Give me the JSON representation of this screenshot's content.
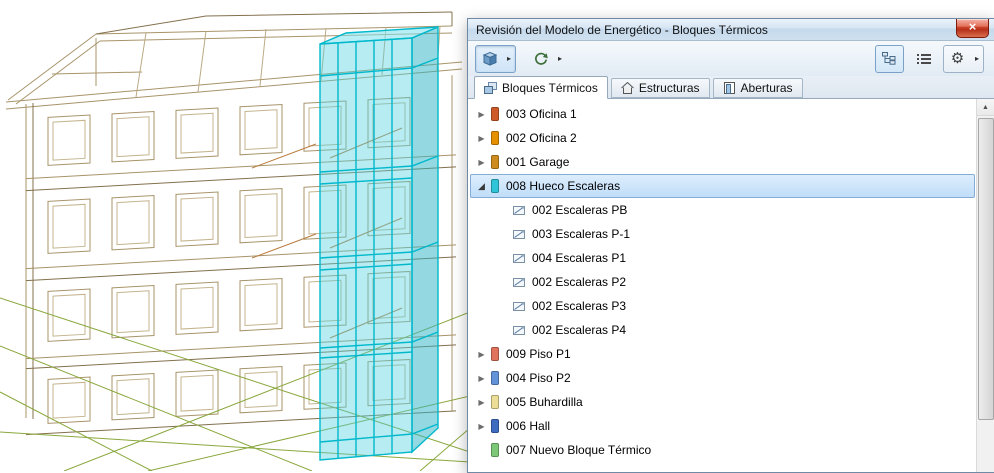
{
  "window": {
    "title": "Revisión del Modelo de Energético - Bloques Térmicos"
  },
  "icons": {
    "close": "×",
    "flyout_arrow": "▸",
    "gear": "⚙",
    "scroll_up": "▲",
    "collapsed_expander": "▶",
    "expanded_expander": "◢"
  },
  "tabs": [
    {
      "label": "Bloques Térmicos",
      "active": true
    },
    {
      "label": "Estructuras",
      "active": false
    },
    {
      "label": "Aberturas",
      "active": false
    }
  ],
  "tree": {
    "items": [
      {
        "label": "003 Oficina 1",
        "color": "#cd5a28",
        "state": "collapsed"
      },
      {
        "label": "002 Oficina 2",
        "color": "#e59000",
        "state": "collapsed"
      },
      {
        "label": "001 Garage",
        "color": "#cf8c1e",
        "state": "collapsed"
      },
      {
        "label": "008 Hueco Escaleras",
        "color": "#2fc4d8",
        "state": "expanded",
        "selected": true,
        "children": [
          {
            "label": "002 Escaleras PB"
          },
          {
            "label": "003 Escaleras P-1"
          },
          {
            "label": "004 Escaleras P1"
          },
          {
            "label": "002 Escaleras P2"
          },
          {
            "label": "002 Escaleras P3"
          },
          {
            "label": "002 Escaleras P4"
          }
        ]
      },
      {
        "label": "009 Piso P1",
        "color": "#e0735c",
        "state": "collapsed"
      },
      {
        "label": "004 Piso P2",
        "color": "#6292d8",
        "state": "collapsed"
      },
      {
        "label": "005 Buhardilla",
        "color": "#ecde96",
        "state": "collapsed"
      },
      {
        "label": "006 Hall",
        "color": "#3e6cc0",
        "state": "collapsed"
      },
      {
        "label": "007 Nuevo Bloque Térmico",
        "color": "#7cc877",
        "state": "leaf"
      }
    ]
  }
}
